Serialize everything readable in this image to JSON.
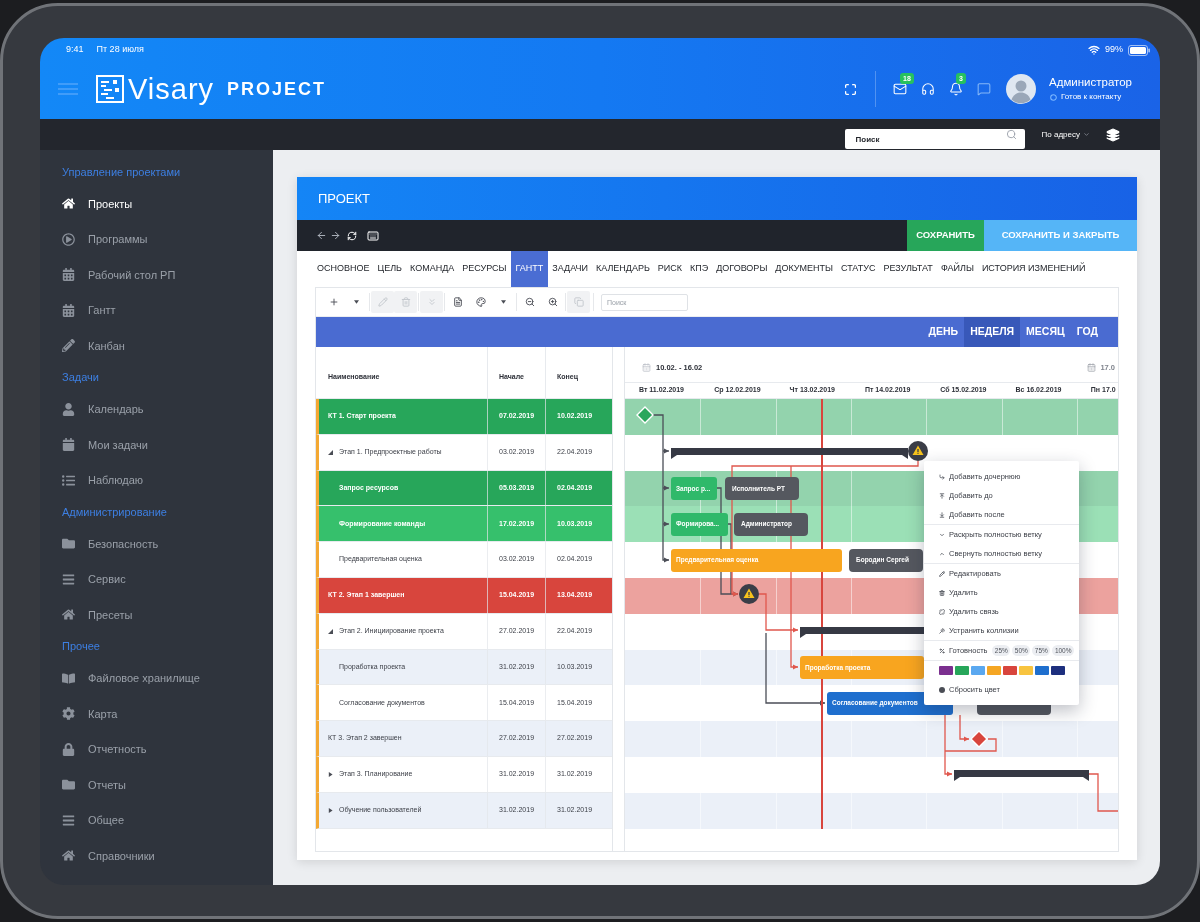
{
  "status_bar": {
    "time": "9:41",
    "date": "Пт 28 июля",
    "battery": "99%"
  },
  "header": {
    "logo": {
      "name": "Visary",
      "product": "PROJECT"
    },
    "icons": [
      {
        "kind": "mail",
        "badge": "18"
      },
      {
        "kind": "support"
      },
      {
        "kind": "bell",
        "badge": "3"
      },
      {
        "kind": "chat"
      }
    ],
    "user": {
      "name": "Администратор",
      "status": "Готов к контакту"
    }
  },
  "search_bar": {
    "placeholder": "Поиск",
    "scope": "По адресу"
  },
  "sidebar": {
    "sections": [
      {
        "title": "Управление проектами",
        "items": [
          {
            "label": "Проекты",
            "selected": true
          },
          {
            "label": "Программы",
            "selected": false
          },
          {
            "label": "Рабочий стол РП",
            "selected": false
          },
          {
            "label": "Гантт",
            "selected": false
          },
          {
            "label": "Канбан",
            "selected": false
          }
        ]
      },
      {
        "title": "Задачи",
        "items": [
          {
            "label": "Календарь",
            "selected": false
          },
          {
            "label": "Мои задачи",
            "selected": false
          },
          {
            "label": "Наблюдаю",
            "selected": false
          }
        ]
      },
      {
        "title": "Администрирование",
        "items": [
          {
            "label": "Безопасность",
            "selected": false
          },
          {
            "label": "Сервис",
            "selected": false
          },
          {
            "label": "Пресеты",
            "selected": false
          }
        ]
      },
      {
        "title": "Прочее",
        "items": [
          {
            "label": "Файловое хранилище",
            "selected": false
          },
          {
            "label": "Карта",
            "selected": false
          },
          {
            "label": "Отчетность",
            "selected": false
          },
          {
            "label": "Отчеты",
            "selected": false
          },
          {
            "label": "Общее",
            "selected": false
          },
          {
            "label": "Справочники",
            "selected": false
          }
        ]
      }
    ]
  },
  "project": {
    "title": "ПРОЕКТ",
    "buttons": [
      {
        "kind": "save",
        "label": "СОХРАНИТЬ"
      },
      {
        "kind": "save_close",
        "label": "СОХРАНИТЬ И ЗАКРЫТЬ"
      }
    ],
    "tabs": [
      {
        "label": "ОСНОВНОЕ",
        "selected": false
      },
      {
        "label": "ЦЕЛЬ",
        "selected": false
      },
      {
        "label": "КОМАНДА",
        "selected": false
      },
      {
        "label": "РЕСУРСЫ",
        "selected": false
      },
      {
        "label": "ГАНТТ",
        "selected": true
      },
      {
        "label": "ЗАДАЧИ",
        "selected": false
      },
      {
        "label": "КАЛЕНДАРЬ",
        "selected": false
      },
      {
        "label": "РИСК",
        "selected": false
      },
      {
        "label": "КПЭ",
        "selected": false
      },
      {
        "label": "ДОГОВОРЫ",
        "selected": false
      },
      {
        "label": "ДОКУМЕНТЫ",
        "selected": false
      },
      {
        "label": "СТАТУС",
        "selected": false
      },
      {
        "label": "РЕЗУЛЬТАТ",
        "selected": false
      },
      {
        "label": "ФАЙЛЫ",
        "selected": false
      },
      {
        "label": "ИСТОРИЯ ИЗМЕНЕНИЙ",
        "selected": false
      }
    ]
  },
  "gantt": {
    "toolbar": {
      "buttons": [
        {
          "disabled": false
        },
        {
          "disabled": false
        },
        {
          "disabled": true
        },
        {
          "disabled": true
        },
        {
          "disabled": true
        },
        {
          "disabled": false
        },
        {
          "disabled": false
        },
        {
          "disabled": false
        },
        {
          "disabled": false
        },
        {
          "disabled": false
        },
        {
          "disabled": true
        }
      ],
      "search": {
        "placeholder": "Поиск"
      }
    },
    "scales": [
      {
        "label": "ДЕНЬ",
        "selected": false
      },
      {
        "label": "НЕДЕЛЯ",
        "selected": true
      },
      {
        "label": "МЕСЯЦ",
        "selected": false
      },
      {
        "label": "ГОД",
        "selected": false
      }
    ],
    "columns": [
      "Наименование",
      "Начале",
      "Конец"
    ],
    "periods": [
      "10.02. - 16.02",
      "17.0"
    ],
    "days": [
      "Вт 11.02.2019",
      "Ср 12.02.2019",
      "Чт 13.02.2019",
      "Пт 14.02.2019",
      "Сб 15.02.2019",
      "Вс 16.02.2019",
      "Пн 17.0"
    ],
    "rows": [
      {
        "name": "КТ 1. Старт проекта",
        "start": "07.02.2019",
        "end": "10.02.2019",
        "color": "#27a65a",
        "bar": {
          "kind": "diamond",
          "color": "#2aa65c"
        }
      },
      {
        "name": "Этап 1. Предпроектные работы",
        "start": "03.02.2019",
        "end": "22.04.2019",
        "color": "#ffffff",
        "expanded": true,
        "bar": {
          "kind": "summary",
          "warning": true
        },
        "children": [
          {
            "name": "Запрос ресурсов",
            "start": "05.03.2019",
            "end": "02.04.2019",
            "color": "#27a65a",
            "bar": {
              "kind": "task",
              "label": "Запрос р...",
              "color": "#2fb96a",
              "resource": "Исполнитель РТ"
            }
          },
          {
            "name": "Формирование команды",
            "start": "17.02.2019",
            "end": "10.03.2019",
            "color": "#36c06c",
            "bar": {
              "kind": "task",
              "label": "Формирова...",
              "color": "#2fb96a",
              "resource": "Администратор"
            }
          },
          {
            "name": "Предварительная оценка",
            "start": "03.02.2019",
            "end": "02.04.2019",
            "color": "#ffffff",
            "bar": {
              "kind": "task",
              "label": "Предварительная оценка",
              "color": "#f8a51f",
              "resource": "Бородин Сергей"
            }
          }
        ]
      },
      {
        "name": "КТ 2. Этап 1 завершен",
        "start": "15.04.2019",
        "end": "13.04.2019",
        "color": "#d8453d",
        "bar": {
          "kind": "warning"
        }
      },
      {
        "name": "Этап 2. Инициирование проекта",
        "start": "27.02.2019",
        "end": "22.04.2019",
        "color": "#ffffff",
        "expanded": true,
        "bar": {
          "kind": "summary"
        },
        "children": [
          {
            "name": "Проработка проекта",
            "start": "31.02.2019",
            "end": "10.03.2019",
            "color": "#ebf0f8",
            "bar": {
              "kind": "task",
              "label": "Проработка проекта",
              "color": "#f8a51f"
            }
          },
          {
            "name": "Согласование документов",
            "start": "15.04.2019",
            "end": "15.04.2019",
            "color": "#ffffff",
            "bar": {
              "kind": "task",
              "label": "Согласование документов",
              "color": "#1f6fce",
              "resource_covered": true
            }
          }
        ]
      },
      {
        "name": "КТ 3. Этап 2 завершен",
        "start": "27.02.2019",
        "end": "27.02.2019",
        "color": "#ebf0f8",
        "bar": {
          "kind": "diamond",
          "color": "#d8453d"
        }
      },
      {
        "name": "Этап 3. Планирование",
        "start": "31.02.2019",
        "end": "31.02.2019",
        "color": "#ffffff",
        "expanded": false,
        "bar": {
          "kind": "summary"
        }
      },
      {
        "name": "Обучение пользователей",
        "start": "31.02.2019",
        "end": "31.02.2019",
        "color": "#ebf0f8",
        "expanded": false
      }
    ],
    "context_menu": {
      "groups": [
        {
          "items": [
            {
              "kind": "action",
              "label": "Добавить дочернюю"
            },
            {
              "kind": "action",
              "label": "Добавить до"
            },
            {
              "kind": "action",
              "label": "Добавить после"
            }
          ]
        },
        {
          "items": [
            {
              "kind": "action",
              "label": "Раскрыть полностью ветку"
            },
            {
              "kind": "action",
              "label": "Свернуть полностью ветку"
            }
          ]
        },
        {
          "items": [
            {
              "kind": "action",
              "label": "Редактировать"
            },
            {
              "kind": "action",
              "label": "Удалить"
            },
            {
              "kind": "action",
              "label": "Удалить связь"
            },
            {
              "kind": "action",
              "label": "Устранить коллизии"
            }
          ]
        },
        {
          "items": [
            {
              "kind": "progress",
              "label": "Готовность",
              "options": [
                "25%",
                "50%",
                "75%",
                "100%"
              ]
            }
          ]
        },
        {
          "items": [
            {
              "kind": "palette",
              "colors": [
                {
                  "color": "#7b2f8f"
                },
                {
                  "color": "#27a65a"
                },
                {
                  "color": "#5aa8f0"
                },
                {
                  "color": "#f5a623"
                },
                {
                  "color": "#d8453d"
                },
                {
                  "color": "#f8c43f"
                },
                {
                  "color": "#1f6fce"
                },
                {
                  "color": "#1d2f7e"
                }
              ]
            },
            {
              "kind": "action",
              "label": "Сбросить цвет"
            }
          ]
        }
      ]
    }
  }
}
